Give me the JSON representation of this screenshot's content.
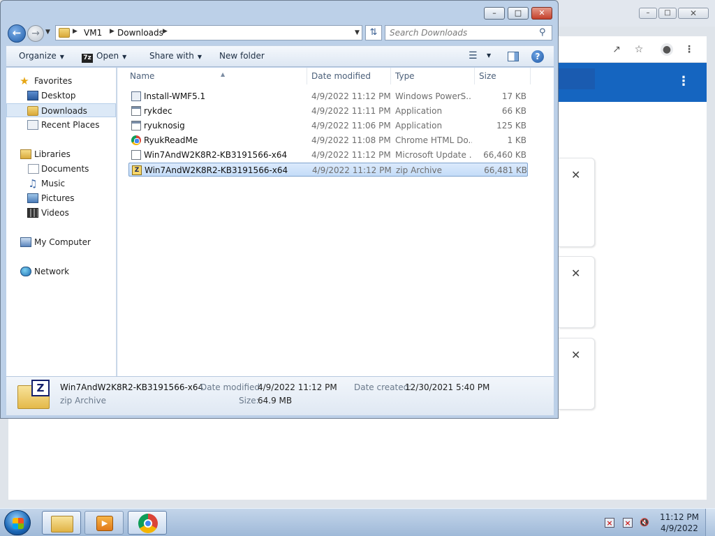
{
  "explorer": {
    "breadcrumb": [
      "VM1",
      "Downloads"
    ],
    "search_placeholder": "Search Downloads",
    "commands": {
      "organize": "Organize",
      "open": "Open",
      "share_with": "Share with",
      "new_folder": "New folder"
    },
    "nav": {
      "favorites": "Favorites",
      "desktop": "Desktop",
      "downloads": "Downloads",
      "recent_places": "Recent Places",
      "libraries": "Libraries",
      "documents": "Documents",
      "music": "Music",
      "pictures": "Pictures",
      "videos": "Videos",
      "my_computer": "My Computer",
      "network": "Network"
    },
    "columns": {
      "name": "Name",
      "date_modified": "Date modified",
      "type": "Type",
      "size": "Size"
    },
    "files": [
      {
        "name": "Install-WMF5.1",
        "date": "4/9/2022 11:12 PM",
        "type": "Windows PowerS...",
        "size": "17 KB",
        "icon": "powershell-script-icon"
      },
      {
        "name": "rykdec",
        "date": "4/9/2022 11:11 PM",
        "type": "Application",
        "size": "66 KB",
        "icon": "application-icon"
      },
      {
        "name": "ryuknosig",
        "date": "4/9/2022 11:06 PM",
        "type": "Application",
        "size": "125 KB",
        "icon": "application-icon"
      },
      {
        "name": "RyukReadMe",
        "date": "4/9/2022 11:08 PM",
        "type": "Chrome HTML Do...",
        "size": "1 KB",
        "icon": "chrome-html-icon"
      },
      {
        "name": "Win7AndW2K8R2-KB3191566-x64",
        "date": "4/9/2022 11:12 PM",
        "type": "Microsoft Update ...",
        "size": "66,460 KB",
        "icon": "msu-file-icon"
      },
      {
        "name": "Win7AndW2K8R2-KB3191566-x64",
        "date": "4/9/2022 11:12 PM",
        "type": "zip Archive",
        "size": "66,481 KB",
        "icon": "zip-archive-icon",
        "selected": true
      }
    ],
    "details": {
      "name": "Win7AndW2K8R2-KB3191566-x64",
      "type": "zip Archive",
      "date_modified_label": "Date modified:",
      "date_modified": "4/9/2022 11:12 PM",
      "date_created_label": "Date created:",
      "date_created": "12/30/2021 5:40 PM",
      "size_label": "Size:",
      "size": "64.9 MB"
    }
  },
  "taskbar": {
    "time": "11:12 PM",
    "date": "4/9/2022"
  }
}
